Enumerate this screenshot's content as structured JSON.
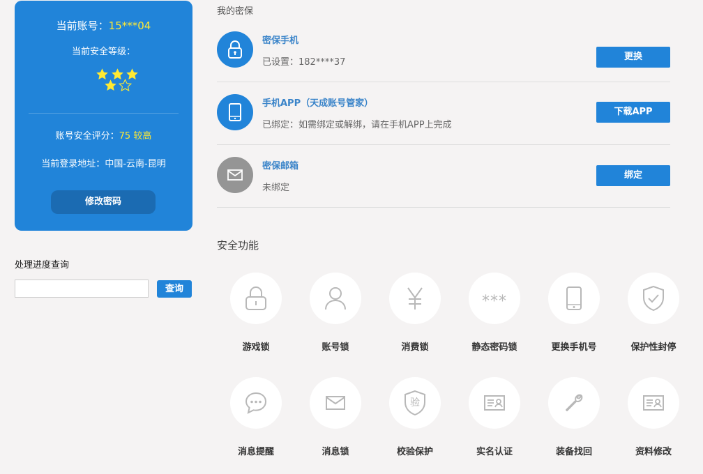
{
  "account": {
    "account_label": "当前账号：",
    "account_value": "15***04",
    "level_label": "当前安全等级：",
    "stars_total": 5,
    "stars_filled": 4,
    "score_label": "账号安全评分：",
    "score_value": "75 较高",
    "location_label": "当前登录地址：",
    "location_value": "中国-云南-昆明",
    "change_password_label": "修改密码"
  },
  "progress_query": {
    "title": "处理进度查询",
    "input_value": "",
    "button_label": "查询"
  },
  "security": {
    "title": "我的密保",
    "items": [
      {
        "icon": "lock-icon",
        "name": "密保手机",
        "desc": "已设置：182****37",
        "button": "更换",
        "status_color": "#2184d9"
      },
      {
        "icon": "phone-icon",
        "name": "手机APP（天成账号管家）",
        "desc": "已绑定：如需绑定或解绑，请在手机APP上完成",
        "button": "下载APP",
        "status_color": "#2184d9"
      },
      {
        "icon": "mail-icon",
        "name": "密保邮箱",
        "desc": "未绑定",
        "button": "绑定",
        "status_color": "#959595"
      }
    ]
  },
  "functions": {
    "title": "安全功能",
    "items": [
      {
        "icon": "lock-icon",
        "label": "游戏锁"
      },
      {
        "icon": "user-icon",
        "label": "账号锁"
      },
      {
        "icon": "yen-icon",
        "label": "消费锁"
      },
      {
        "icon": "asterisk-password-icon",
        "label": "静态密码锁",
        "glyph": "***"
      },
      {
        "icon": "mobile-icon",
        "label": "更换手机号"
      },
      {
        "icon": "shield-check-icon",
        "label": "保护性封停"
      },
      {
        "icon": "chat-bubble-icon",
        "label": "消息提醒"
      },
      {
        "icon": "envelope-icon",
        "label": "消息锁"
      },
      {
        "icon": "shield-verify-icon",
        "label": "校验保护",
        "glyph": "验"
      },
      {
        "icon": "id-card-icon",
        "label": "实名认证"
      },
      {
        "icon": "wrench-icon",
        "label": "装备找回"
      },
      {
        "icon": "profile-card-icon",
        "label": "资料修改"
      }
    ]
  },
  "colors": {
    "primary": "#2184d9",
    "highlight": "#ffe933",
    "link": "#3a84c9",
    "icon_gray": "#b8b8b8"
  }
}
